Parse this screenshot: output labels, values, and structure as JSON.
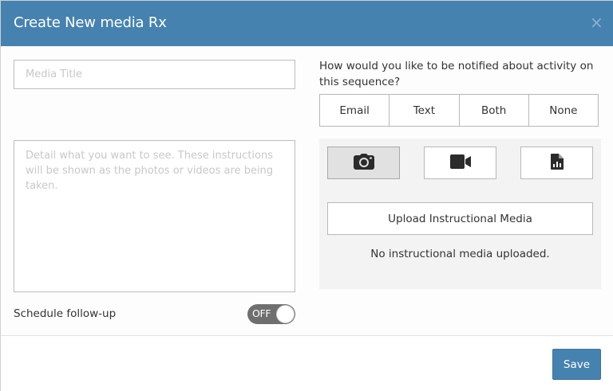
{
  "modal": {
    "title": "Create New media Rx",
    "close_symbol": "×"
  },
  "form": {
    "title_placeholder": "Media Title",
    "title_value": "",
    "instructions_placeholder": "Detail what you want to see. These instructions will be shown as the photos or videos are being taken.",
    "instructions_value": "",
    "followup_label": "Schedule follow-up",
    "followup_toggle": {
      "state_label": "OFF",
      "on": false
    }
  },
  "notifications": {
    "question": "How would you like to be notified about activity on this sequence?",
    "options": [
      "Email",
      "Text",
      "Both",
      "None"
    ]
  },
  "media": {
    "types": [
      {
        "icon": "camera-icon",
        "active": true
      },
      {
        "icon": "video-camera-icon",
        "active": false
      },
      {
        "icon": "document-chart-icon",
        "active": false
      }
    ],
    "upload_label": "Upload Instructional Media",
    "empty_message": "No instructional media uploaded."
  },
  "footer": {
    "save_label": "Save"
  },
  "colors": {
    "header_bg": "#4682b0",
    "primary_button": "#4682b0",
    "toggle_off": "#6f6f6f",
    "active_media_bg": "#e1e1e1"
  }
}
